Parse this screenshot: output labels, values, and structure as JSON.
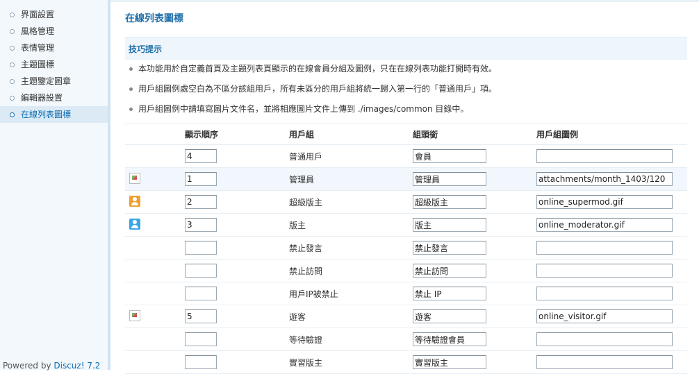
{
  "sidebar": {
    "items": [
      {
        "label": "界面設置",
        "active": false
      },
      {
        "label": "風格管理",
        "active": false
      },
      {
        "label": "表情管理",
        "active": false
      },
      {
        "label": "主題圖標",
        "active": false
      },
      {
        "label": "主題鑒定圖章",
        "active": false
      },
      {
        "label": "編輯器設置",
        "active": false
      },
      {
        "label": "在線列表圖標",
        "active": true
      }
    ],
    "powered_prefix": "Powered by ",
    "powered_link": "Discuz! 7.2"
  },
  "main": {
    "title": "在線列表圖標",
    "tip_title": "技巧提示",
    "tips": [
      "本功能用於自定義首頁及主題列表頁顯示的在線會員分組及圖例，只在在線列表功能打開時有效。",
      "用戶組圖例處空白為不區分該組用戶，所有未區分的用戶組將統一歸入第一行的「普通用戶」項。",
      "用戶組圖例中請填寫圖片文件名，並將相應圖片文件上傳到 ./images/common 目錄中。"
    ],
    "table": {
      "headers": {
        "order": "顯示順序",
        "group": "用戶組",
        "head": "組頭銜",
        "image": "用戶組圖例"
      },
      "rows": [
        {
          "icon": "none",
          "order": "4",
          "group": "普通用戶",
          "head": "會員",
          "image": ""
        },
        {
          "icon": "broken-image-icon",
          "order": "1",
          "group": "管理員",
          "head": "管理員",
          "image": "attachments/month_1403/120"
        },
        {
          "icon": "supermod-icon",
          "order": "2",
          "group": "超級版主",
          "head": "超級版主",
          "image": "online_supermod.gif"
        },
        {
          "icon": "moderator-icon",
          "order": "3",
          "group": "版主",
          "head": "版主",
          "image": "online_moderator.gif"
        },
        {
          "icon": "none",
          "order": "",
          "group": "禁止發言",
          "head": "禁止發言",
          "image": ""
        },
        {
          "icon": "none",
          "order": "",
          "group": "禁止訪問",
          "head": "禁止訪問",
          "image": ""
        },
        {
          "icon": "none",
          "order": "",
          "group": "用戶IP被禁止",
          "head": "禁止 IP",
          "image": ""
        },
        {
          "icon": "broken-image-icon",
          "order": "5",
          "group": "遊客",
          "head": "遊客",
          "image": "online_visitor.gif"
        },
        {
          "icon": "none",
          "order": "",
          "group": "等待驗證",
          "head": "等待驗證會員",
          "image": ""
        },
        {
          "icon": "none",
          "order": "",
          "group": "實習版主",
          "head": "實習版主",
          "image": ""
        }
      ]
    }
  }
}
